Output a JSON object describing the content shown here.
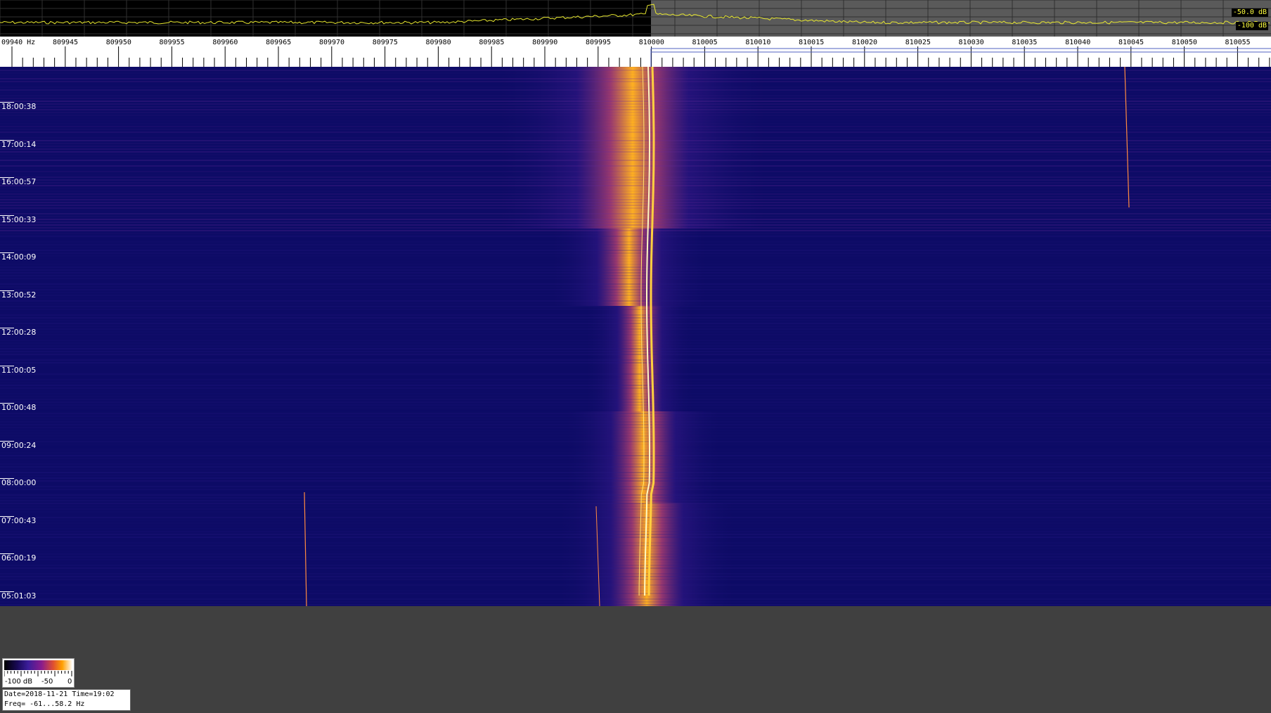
{
  "spectrum": {
    "db_top_label": "-50.0 dB",
    "db_bottom_label": "-100 dB",
    "trace_color": "#e8e830"
  },
  "freq_scale": {
    "first_label": "09940 Hz",
    "labels": [
      "809945",
      "809950",
      "809955",
      "809960",
      "809965",
      "809970",
      "809975",
      "809980",
      "809985",
      "809990",
      "809995",
      "810000",
      "810005",
      "810010",
      "810015",
      "810020",
      "810025",
      "810030",
      "810035",
      "810040",
      "810045",
      "810050",
      "810055"
    ]
  },
  "waterfall": {
    "time_labels": [
      "18:00:38",
      "17:00:14",
      "16:00:57",
      "15:00:33",
      "14:00:09",
      "13:00:52",
      "12:00:28",
      "11:00:05",
      "10:00:48",
      "09:00:24",
      "08:00:00",
      "07:00:43",
      "06:00:19",
      "05:01:03"
    ],
    "background_color": "#0d0b66",
    "hot_color": "#ffb020"
  },
  "colorbar": {
    "min_label": "-100 dB",
    "mid_label": "-50",
    "max_label": "0"
  },
  "info": {
    "line1": "Date=2018-11-21 Time=19:02",
    "line2": "Freq= -61...58.2 Hz"
  }
}
